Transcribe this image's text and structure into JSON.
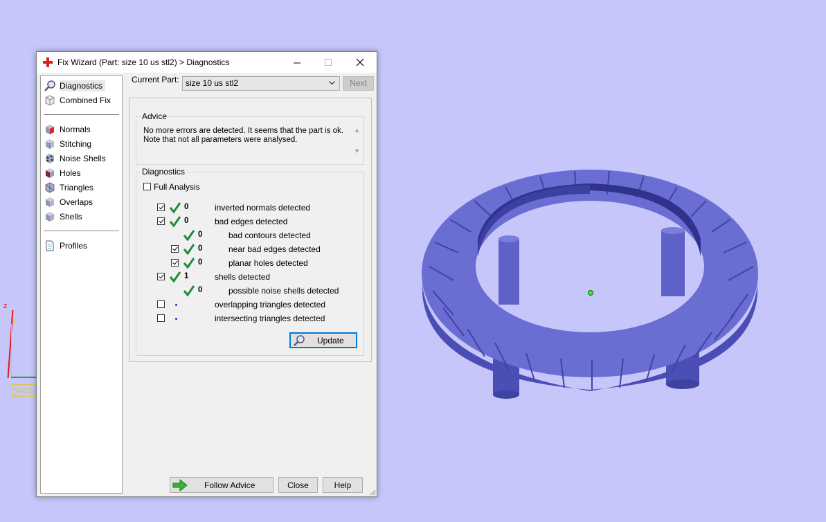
{
  "viewport": {
    "axis_z_label": "z",
    "axis_y_label": "y",
    "wcs_label": "WCS",
    "background_color": "#c6c6fb",
    "model_color": "#5b5fc7"
  },
  "dialog": {
    "title": "Fix Wizard (Part: size 10 us stl2) > Diagnostics",
    "title_icon": "red-cross-icon",
    "sidebar": {
      "group1": [
        {
          "label": "Diagnostics",
          "icon": "magnifier-icon",
          "selected": true
        },
        {
          "label": "Combined Fix",
          "icon": "cube-outline-icon"
        }
      ],
      "group2": [
        {
          "label": "Normals",
          "icon": "cube-red-icon"
        },
        {
          "label": "Stitching",
          "icon": "cube-stitch-icon"
        },
        {
          "label": "Noise Shells",
          "icon": "cube-noise-icon"
        },
        {
          "label": "Holes",
          "icon": "cube-holes-icon"
        },
        {
          "label": "Triangles",
          "icon": "cube-triangles-icon"
        },
        {
          "label": "Overlaps",
          "icon": "cube-overlaps-icon"
        },
        {
          "label": "Shells",
          "icon": "cube-shells-icon"
        }
      ],
      "group3": [
        {
          "label": "Profiles",
          "icon": "document-icon"
        }
      ]
    },
    "current_part_label": "Current Part:",
    "current_part_value": "size 10 us stl2",
    "next_label": "Next",
    "advice": {
      "title": "Advice",
      "line1": "No more errors are detected. It seems that the part is ok.",
      "line2": "Note that not all parameters were analysed."
    },
    "diagnostics": {
      "title": "Diagnostics",
      "full_analysis_label": "Full Analysis",
      "full_analysis_checked": false,
      "rows": [
        {
          "label": "inverted normals detected",
          "value": "0",
          "checkbox": true,
          "checked": true,
          "status": "ok"
        },
        {
          "label": "bad edges detected",
          "value": "0",
          "checkbox": true,
          "checked": true,
          "status": "ok"
        },
        {
          "label": "bad contours detected",
          "value": "0",
          "checkbox": false,
          "status": "ok"
        },
        {
          "label": "near bad edges detected",
          "value": "0",
          "checkbox": true,
          "checked": true,
          "status": "ok"
        },
        {
          "label": "planar holes detected",
          "value": "0",
          "checkbox": true,
          "checked": true,
          "status": "ok"
        },
        {
          "label": "shells detected",
          "value": "1",
          "checkbox": true,
          "checked": true,
          "status": "ok"
        },
        {
          "label": "possible noise shells detected",
          "value": "0",
          "checkbox": false,
          "status": "ok"
        },
        {
          "label": "overlapping triangles detected",
          "value": "",
          "checkbox": true,
          "checked": false,
          "status": "pending"
        },
        {
          "label": "intersecting triangles detected",
          "value": "",
          "checkbox": true,
          "checked": false,
          "status": "pending"
        }
      ]
    },
    "update_label": "Update",
    "follow_advice_label": "Follow Advice",
    "close_label": "Close",
    "help_label": "Help"
  }
}
